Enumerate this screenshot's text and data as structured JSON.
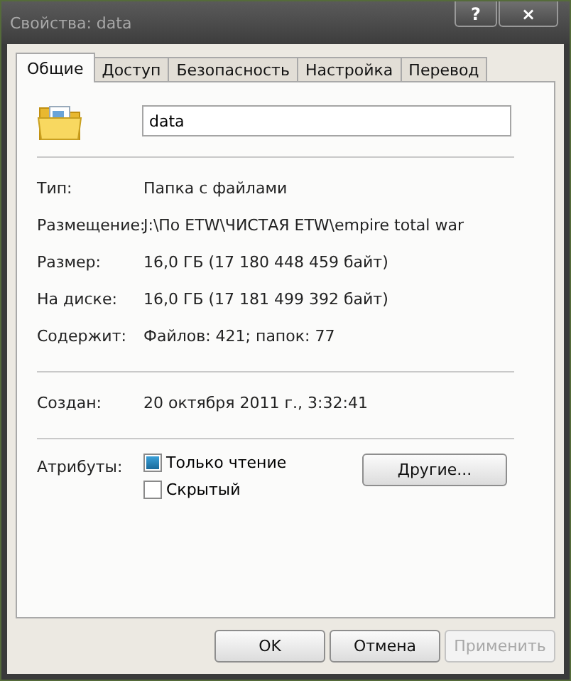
{
  "window": {
    "title": "Свойства: data",
    "help_button": "?",
    "close_button": "×"
  },
  "tabs": [
    {
      "label": "Общие",
      "selected": true
    },
    {
      "label": "Доступ",
      "selected": false
    },
    {
      "label": "Безопасность",
      "selected": false
    },
    {
      "label": "Настройка",
      "selected": false
    },
    {
      "label": "Перевод",
      "selected": false
    }
  ],
  "name_field": {
    "value": "data"
  },
  "info_groups": [
    [
      {
        "label": "Тип:",
        "value": "Папка с файлами"
      },
      {
        "label": "Размещение:",
        "value": "J:\\По ETW\\ЧИСТАЯ ETW\\empire total war"
      },
      {
        "label": "Размер:",
        "value": "16,0 ГБ (17 180 448 459 байт)"
      },
      {
        "label": "На диске:",
        "value": "16,0 ГБ (17 181 499 392 байт)"
      },
      {
        "label": "Содержит:",
        "value": "Файлов: 421; папок: 77"
      }
    ],
    [
      {
        "label": "Создан:",
        "value": "20 октября 2011 г., 3:32:41"
      }
    ]
  ],
  "attributes": {
    "label": "Атрибуты:",
    "checkboxes": [
      {
        "label": "Только чтение",
        "checked": true
      },
      {
        "label": "Скрытый",
        "checked": false
      }
    ],
    "button": "Другие..."
  },
  "buttons": [
    {
      "label": "OK",
      "disabled": false
    },
    {
      "label": "Отмена",
      "disabled": false
    },
    {
      "label": "Применить",
      "disabled": true
    }
  ]
}
